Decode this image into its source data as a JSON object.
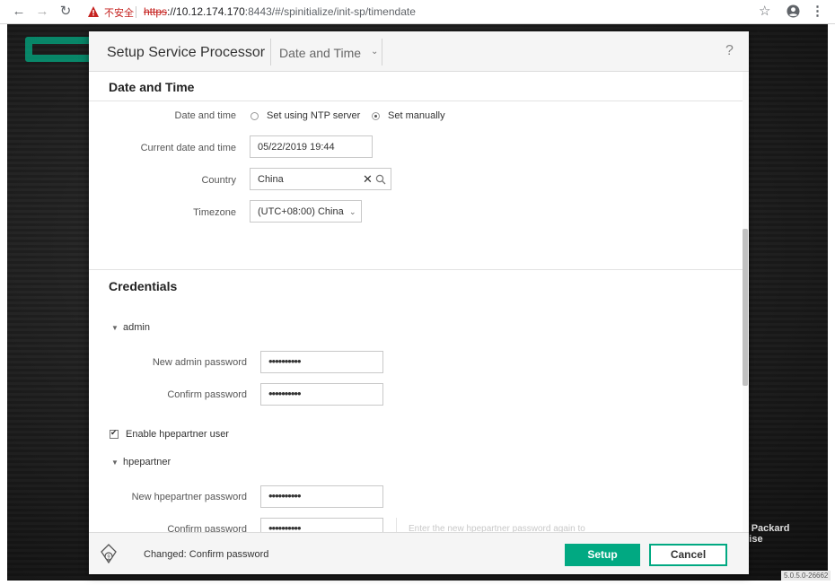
{
  "browser": {
    "insecure_label": "不安全",
    "url_scheme": "https",
    "url_host": "://10.12.174.170",
    "url_rest": ":8443/#/spinitialize/init-sp/timendate"
  },
  "background": {
    "brand_line1": "t Packard",
    "brand_line2": "rise",
    "version": "5.0.5.0-26662"
  },
  "dialog": {
    "title": "Setup Service Processor",
    "step": "Date and Time",
    "help": "?"
  },
  "date_time": {
    "section_title": "Date and Time",
    "mode_label": "Date and time",
    "option_ntp": "Set using NTP server",
    "option_manual": "Set manually",
    "selected": "manual",
    "current_label": "Current date and time",
    "current_value": "05/22/2019 19:44",
    "country_label": "Country",
    "country_value": "China",
    "timezone_label": "Timezone",
    "timezone_value": "(UTC+08:00) China"
  },
  "credentials": {
    "section_title": "Credentials",
    "admin_group": "admin",
    "admin_new_label": "New admin password",
    "admin_new_value": "••••••••••",
    "admin_confirm_label": "Confirm password",
    "admin_confirm_value": "••••••••••",
    "enable_partner_label": "Enable hpepartner user",
    "enable_partner_checked": true,
    "partner_group": "hpepartner",
    "partner_new_label": "New hpepartner password",
    "partner_new_value": "••••••••••",
    "partner_confirm_label": "Confirm password",
    "partner_confirm_value": "••••••••••",
    "partner_confirm_hint": "Enter the new hpepartner password again to"
  },
  "footer": {
    "status": "Changed: Confirm password",
    "setup_label": "Setup",
    "cancel_label": "Cancel"
  },
  "colors": {
    "accent": "#01a982",
    "insecure": "#c5221f"
  }
}
